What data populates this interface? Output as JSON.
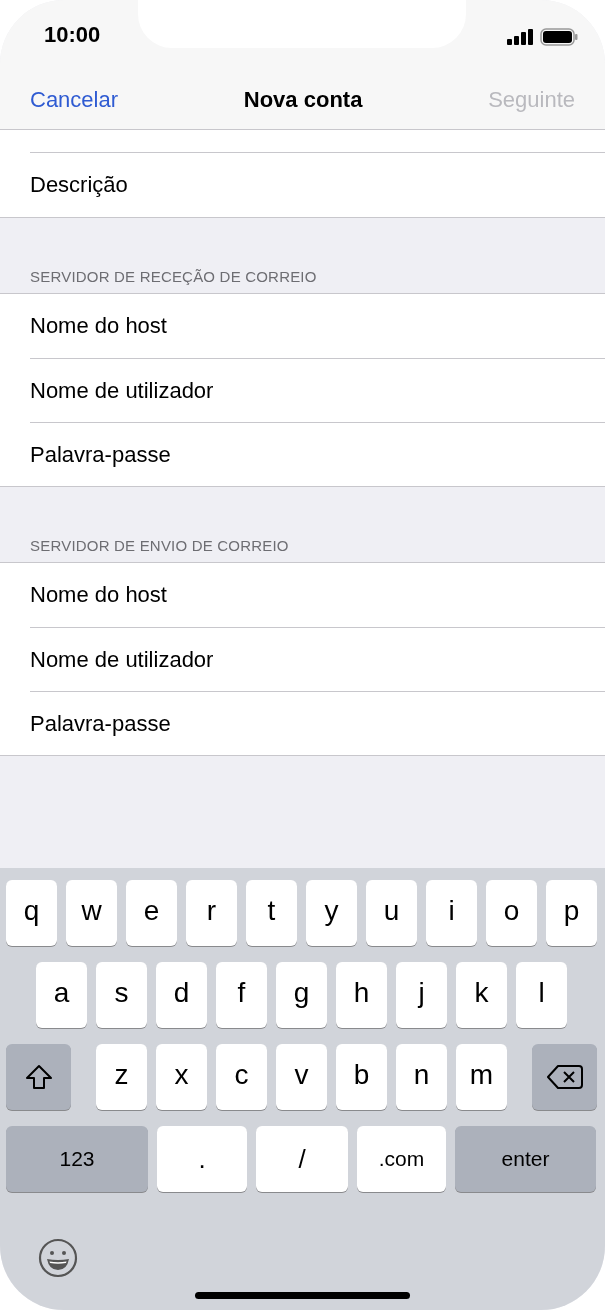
{
  "status_bar": {
    "time": "10:00"
  },
  "nav_bar": {
    "cancel": "Cancelar",
    "title": "Nova conta",
    "next": {
      "label": "Seguinte",
      "disabled": true
    }
  },
  "sections": [
    {
      "rows": [
        {
          "label": "Descrição"
        }
      ]
    },
    {
      "header": "SERVIDOR DE RECEÇÃO DE CORREIO",
      "rows": [
        {
          "label": "Nome do host"
        },
        {
          "label": "Nome de utilizador"
        },
        {
          "label": "Palavra-passe"
        }
      ]
    },
    {
      "header": "SERVIDOR DE ENVIO DE CORREIO",
      "rows": [
        {
          "label": "Nome do host"
        },
        {
          "label": "Nome de utilizador"
        },
        {
          "label": "Palavra-passe"
        }
      ]
    }
  ],
  "keyboard": {
    "key_rows": [
      {
        "keys": [
          {
            "kind": "letter",
            "label": "q"
          },
          {
            "kind": "letter",
            "label": "w"
          },
          {
            "kind": "letter",
            "label": "e"
          },
          {
            "kind": "letter",
            "label": "r"
          },
          {
            "kind": "letter",
            "label": "t"
          },
          {
            "kind": "letter",
            "label": "y"
          },
          {
            "kind": "letter",
            "label": "u"
          },
          {
            "kind": "letter",
            "label": "i"
          },
          {
            "kind": "letter",
            "label": "o"
          },
          {
            "kind": "letter",
            "label": "p"
          }
        ]
      },
      {
        "keys": [
          {
            "kind": "letter",
            "label": "a"
          },
          {
            "kind": "letter",
            "label": "s"
          },
          {
            "kind": "letter",
            "label": "d"
          },
          {
            "kind": "letter",
            "label": "f"
          },
          {
            "kind": "letter",
            "label": "g"
          },
          {
            "kind": "letter",
            "label": "h"
          },
          {
            "kind": "letter",
            "label": "j"
          },
          {
            "kind": "letter",
            "label": "k"
          },
          {
            "kind": "letter",
            "label": "l"
          }
        ]
      },
      {
        "keys": [
          {
            "kind": "shift"
          },
          {
            "kind": "letter",
            "label": "z"
          },
          {
            "kind": "letter",
            "label": "x"
          },
          {
            "kind": "letter",
            "label": "c"
          },
          {
            "kind": "letter",
            "label": "v"
          },
          {
            "kind": "letter",
            "label": "b"
          },
          {
            "kind": "letter",
            "label": "n"
          },
          {
            "kind": "letter",
            "label": "m"
          },
          {
            "kind": "delete"
          }
        ]
      },
      {
        "keys": [
          {
            "kind": "numbers",
            "label": "123"
          },
          {
            "kind": "char",
            "label": "."
          },
          {
            "kind": "char",
            "label": "/"
          },
          {
            "kind": "domain",
            "label": ".com"
          },
          {
            "kind": "return",
            "label": "enter"
          }
        ]
      }
    ],
    "bottom": [
      {
        "kind": "emoji"
      }
    ]
  }
}
